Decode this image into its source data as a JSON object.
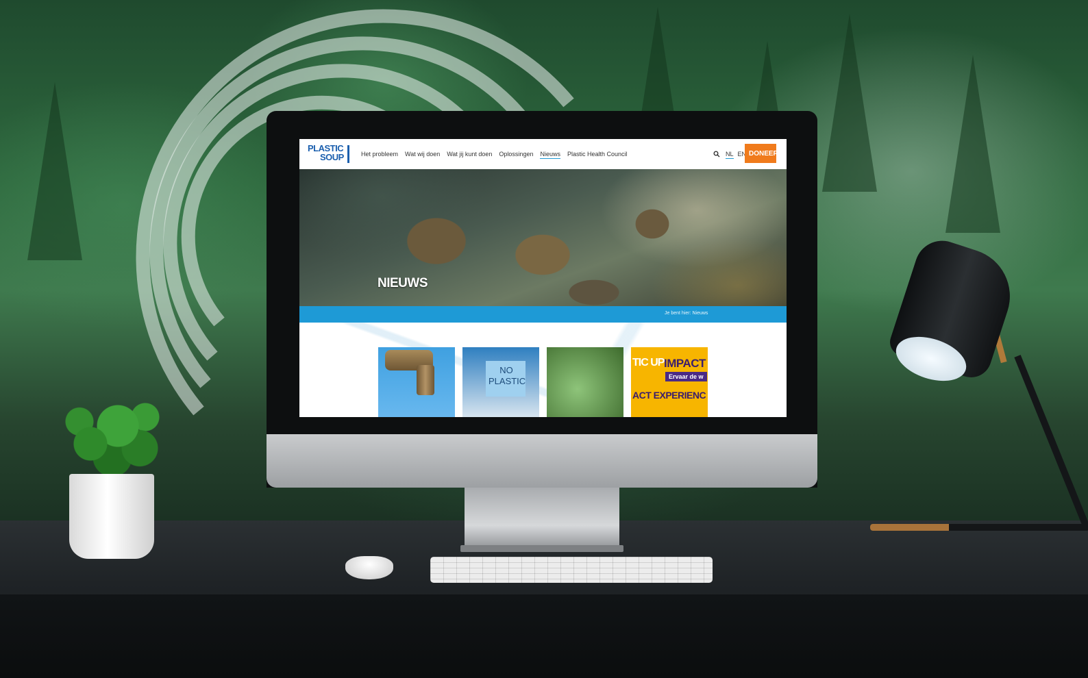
{
  "colors": {
    "brand_blue": "#1b5fae",
    "accent_blue": "#1e9ad6",
    "donate_orange": "#f07b1c",
    "impact_yellow": "#f7b500",
    "impact_purple": "#3a1d6e"
  },
  "site": {
    "logo": {
      "line1": "PLASTIC",
      "line2": "SOUP"
    },
    "nav": {
      "items": [
        {
          "label": "Het probleem"
        },
        {
          "label": "Wat wij doen"
        },
        {
          "label": "Wat jij kunt doen"
        },
        {
          "label": "Oplossingen"
        },
        {
          "label": "Nieuws",
          "active": true
        },
        {
          "label": "Plastic Health Council"
        }
      ],
      "search_icon": "search-icon",
      "languages": [
        {
          "label": "NL",
          "active": true
        },
        {
          "label": "EN"
        }
      ],
      "donate_label": "DONEER"
    },
    "hero": {
      "title": "NIEUWS"
    },
    "breadcrumb": "Je bent hier: Nieuws",
    "cards": {
      "card2_text": "NO PLASTIC",
      "card4": {
        "side_text": "TIC UP",
        "headline": "IMPACT",
        "tag": "Ervaar de w",
        "bottom_text": "ACT EXPERIENC"
      }
    }
  }
}
